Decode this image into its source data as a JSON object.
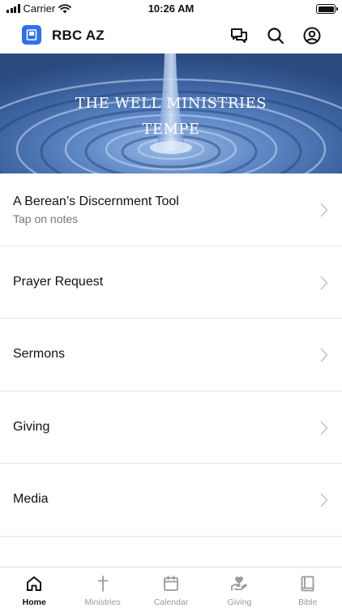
{
  "status_bar": {
    "carrier": "Carrier",
    "time": "10:26 AM"
  },
  "header": {
    "app_name": "RBC AZ"
  },
  "hero": {
    "line1": "THE WELL MINISTRIES",
    "line2": "TEMPE"
  },
  "list": [
    {
      "label": "A Berean’s Discernment Tool",
      "subtitle": "Tap on notes"
    },
    {
      "label": "Prayer Request"
    },
    {
      "label": "Sermons"
    },
    {
      "label": "Giving"
    },
    {
      "label": "Media"
    }
  ],
  "tabs": [
    {
      "label": "Home",
      "icon": "home-icon",
      "active": true
    },
    {
      "label": "Ministries",
      "icon": "cross-icon",
      "active": false
    },
    {
      "label": "Calendar",
      "icon": "calendar-icon",
      "active": false
    },
    {
      "label": "Giving",
      "icon": "giving-hand-icon",
      "active": false
    },
    {
      "label": "Bible",
      "icon": "book-icon",
      "active": false
    }
  ],
  "colors": {
    "accent": "#2f6ff0",
    "hero_water": "#4f79b8",
    "text_primary": "#111111",
    "text_secondary": "#777777",
    "tab_inactive": "#9a9a9a"
  }
}
